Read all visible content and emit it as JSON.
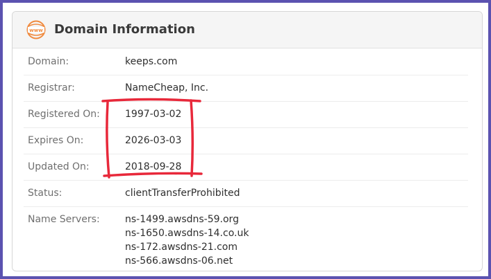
{
  "header": {
    "icon": "www-globe-icon",
    "icon_text": "www",
    "title": "Domain Information"
  },
  "rows": [
    {
      "label": "Domain:",
      "value": "keeps.com"
    },
    {
      "label": "Registrar:",
      "value": "NameCheap, Inc."
    },
    {
      "label": "Registered On:",
      "value": "1997-03-02"
    },
    {
      "label": "Expires On:",
      "value": "2026-03-03"
    },
    {
      "label": "Updated On:",
      "value": "2018-09-28"
    },
    {
      "label": "Status:",
      "value": "clientTransferProhibited"
    }
  ],
  "name_servers": {
    "label": "Name Servers:",
    "values": [
      "ns-1499.awsdns-59.org",
      "ns-1650.awsdns-14.co.uk",
      "ns-172.awsdns-21.com",
      "ns-566.awsdns-06.net"
    ]
  },
  "colors": {
    "frame": "#5b52b0",
    "icon": "#f08a3e",
    "annotation": "#e8283a"
  }
}
